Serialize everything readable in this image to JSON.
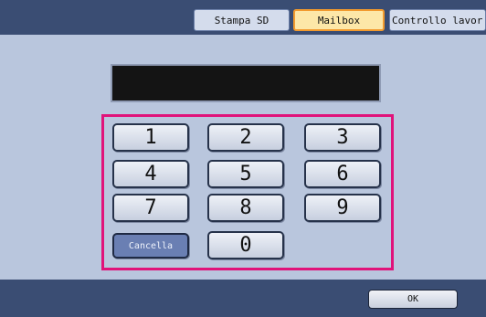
{
  "tabs": {
    "stampa": "Stampa SD",
    "mailbox": "Mailbox",
    "controllo": "Controllo lavor"
  },
  "display": {
    "value": ""
  },
  "keypad": {
    "keys": [
      "1",
      "2",
      "3",
      "4",
      "5",
      "6",
      "7",
      "8",
      "9",
      "0"
    ],
    "cancel": "Cancella"
  },
  "footer": {
    "ok": "OK"
  },
  "colors": {
    "bar": "#3a4d73",
    "panel": "#b9c6dd",
    "highlight_frame": "#e0137a",
    "active_tab": "#fde7a8",
    "active_tab_border": "#f29a2e"
  }
}
